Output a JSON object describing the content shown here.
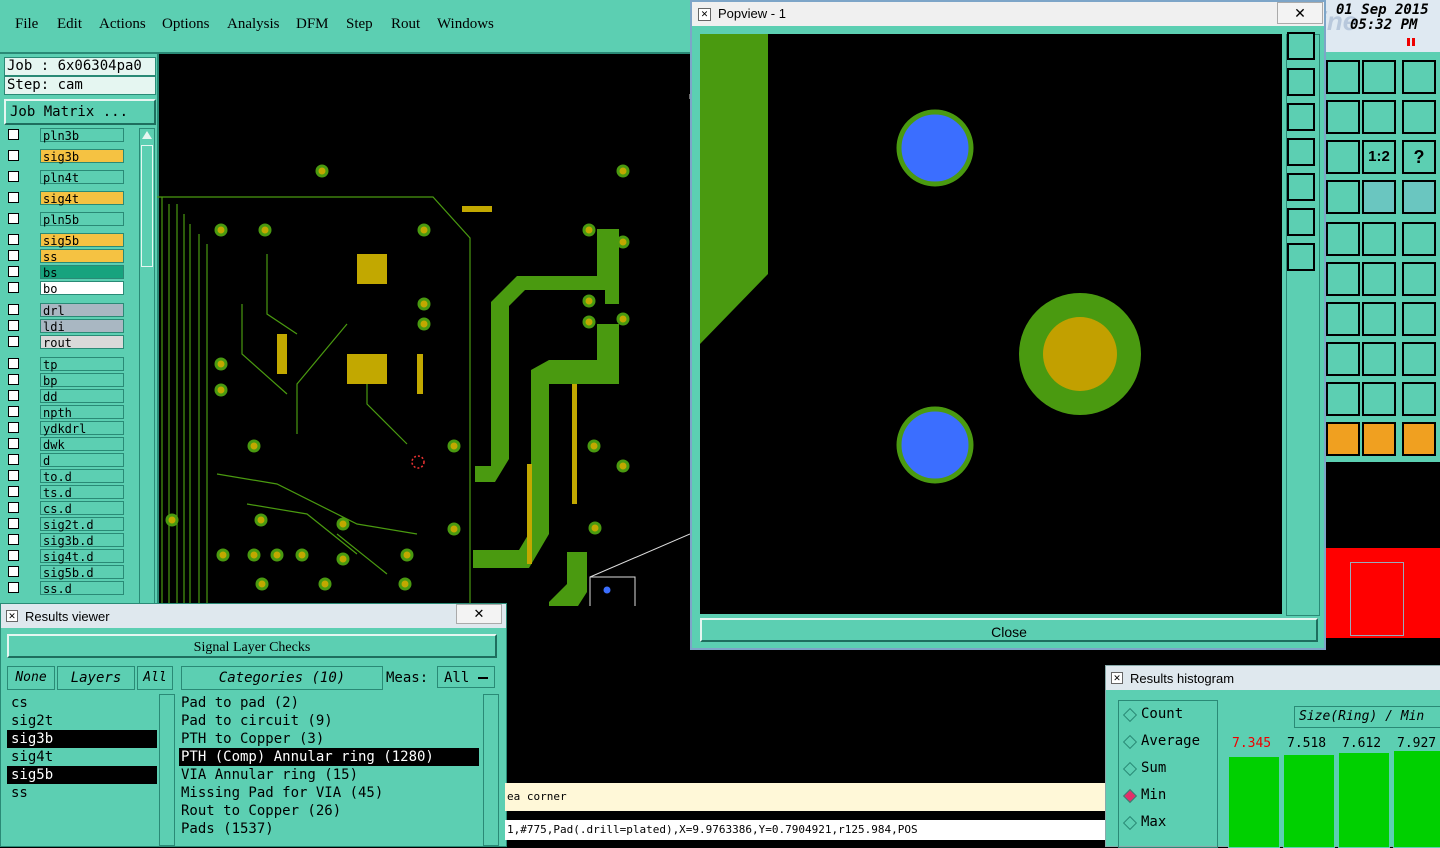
{
  "menubar": {
    "items": [
      "File",
      "Edit",
      "Actions",
      "Options",
      "Analysis",
      "DFM",
      "Step",
      "Rout",
      "Windows"
    ]
  },
  "header": {
    "date": "01 Sep 2015",
    "time": "05:32 PM",
    "bg_text": "Frontline"
  },
  "job": {
    "job_label": "Job : 6x06304pa0",
    "step_label": "Step: cam",
    "matrix_button": "Job Matrix ..."
  },
  "layers": [
    {
      "name": "pln3b",
      "color": "#5ccfb2"
    },
    {
      "name": "sig3b",
      "color": "#f5c242"
    },
    {
      "name": "pln4t",
      "color": "#5ccfb2"
    },
    {
      "name": "sig4t",
      "color": "#f5c242"
    },
    {
      "name": "pln5b",
      "color": "#5ccfb2"
    },
    {
      "name": "sig5b",
      "color": "#f5c242"
    },
    {
      "name": "ss",
      "color": "#f5c242"
    },
    {
      "name": "bs",
      "color": "#17a37e"
    },
    {
      "name": "bo",
      "color": "#ffffff"
    },
    {
      "name": "drl",
      "color": "#a9b7c2"
    },
    {
      "name": "ldi",
      "color": "#a9b7c2"
    },
    {
      "name": "rout",
      "color": "#d9d9d9"
    },
    {
      "name": "tp",
      "color": "#5ccfb2"
    },
    {
      "name": "bp",
      "color": "#5ccfb2"
    },
    {
      "name": "dd",
      "color": "#5ccfb2"
    },
    {
      "name": "npth",
      "color": "#5ccfb2"
    },
    {
      "name": "ydkdrl",
      "color": "#5ccfb2"
    },
    {
      "name": "dwk",
      "color": "#5ccfb2"
    },
    {
      "name": "d",
      "color": "#5ccfb2"
    },
    {
      "name": "to.d",
      "color": "#5ccfb2"
    },
    {
      "name": "ts.d",
      "color": "#5ccfb2"
    },
    {
      "name": "cs.d",
      "color": "#5ccfb2"
    },
    {
      "name": "sig2t.d",
      "color": "#5ccfb2"
    },
    {
      "name": "sig3b.d",
      "color": "#5ccfb2"
    },
    {
      "name": "sig4t.d",
      "color": "#5ccfb2"
    },
    {
      "name": "sig5b.d",
      "color": "#5ccfb2"
    },
    {
      "name": "ss.d",
      "color": "#5ccfb2"
    }
  ],
  "popview": {
    "title": "Popview - 1",
    "close_button": "Close",
    "close_x": "✕"
  },
  "results_viewer": {
    "title": "Results viewer",
    "heading": "Signal Layer Checks",
    "none_button": "None",
    "layers_button": "Layers",
    "all_button": "All",
    "categories_label": "Categories (10)",
    "meas_label": "Meas:",
    "meas_value": "All",
    "layer_list": [
      {
        "name": "cs",
        "selected": false
      },
      {
        "name": "sig2t",
        "selected": false
      },
      {
        "name": "sig3b",
        "selected": true
      },
      {
        "name": "sig4t",
        "selected": false
      },
      {
        "name": "sig5b",
        "selected": true
      },
      {
        "name": "ss",
        "selected": false
      }
    ],
    "categories": [
      {
        "name": "Pad to pad (2)",
        "selected": false
      },
      {
        "name": "Pad to circuit (9)",
        "selected": false
      },
      {
        "name": "PTH to Copper (3)",
        "selected": false
      },
      {
        "name": "PTH (Comp) Annular ring (1280)",
        "selected": true
      },
      {
        "name": "VIA Annular ring (15)",
        "selected": false
      },
      {
        "name": "Missing Pad for VIA (45)",
        "selected": false
      },
      {
        "name": "Rout to Copper (26)",
        "selected": false
      },
      {
        "name": "Pads (1537)",
        "selected": false
      }
    ]
  },
  "status": {
    "line1": "ea corner",
    "line2": "1,#775,Pad(.drill=plated),X=9.9763386,Y=0.7904921,r125.984,POS"
  },
  "histogram": {
    "title": "Results histogram",
    "options": [
      "Count",
      "Average",
      "Sum",
      "Min",
      "Max"
    ],
    "selected_option": "Min",
    "axis_label": "Size(Ring) / Min",
    "values": [
      "7.345",
      "7.518",
      "7.612",
      "7.927"
    ]
  }
}
